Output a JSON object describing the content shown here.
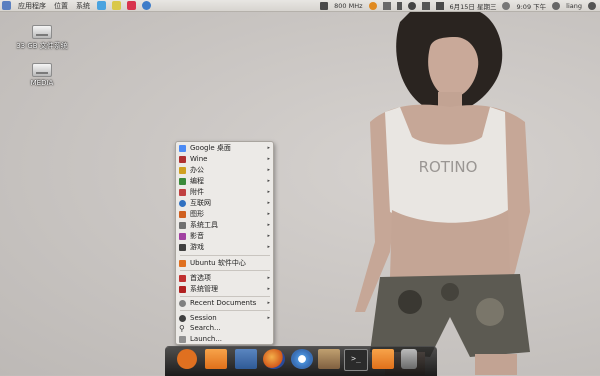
{
  "panel": {
    "menus": [
      "应用程序",
      "位置",
      "系统"
    ],
    "cpu": "800 MHz",
    "datetime": "6月15日 星期三",
    "time": "9:09 下午",
    "user": "liang"
  },
  "desktop": {
    "icons": [
      {
        "label": "33 GB 文件系统"
      },
      {
        "label": "MEDIA"
      }
    ]
  },
  "menu": {
    "items": [
      {
        "label": "Google 桌面",
        "icon": "google-icon",
        "color": "#4c8bf5",
        "submenu": true
      },
      {
        "label": "Wine",
        "icon": "wine-icon",
        "color": "#b03030",
        "submenu": true
      },
      {
        "label": "办公",
        "icon": "office-icon",
        "color": "#d0a020",
        "submenu": true
      },
      {
        "label": "编程",
        "icon": "programming-icon",
        "color": "#3a8a3a",
        "submenu": true
      },
      {
        "label": "附件",
        "icon": "accessories-icon",
        "color": "#c04040",
        "submenu": true
      },
      {
        "label": "互联网",
        "icon": "internet-icon",
        "color": "#3070c0",
        "submenu": true
      },
      {
        "label": "图形",
        "icon": "graphics-icon",
        "color": "#d06020",
        "submenu": true
      },
      {
        "label": "系统工具",
        "icon": "system-tools-icon",
        "color": "#707070",
        "submenu": true
      },
      {
        "label": "影音",
        "icon": "multimedia-icon",
        "color": "#a040a0",
        "submenu": true
      },
      {
        "label": "游戏",
        "icon": "games-icon",
        "color": "#404040",
        "submenu": true
      },
      {
        "label": "Ubuntu 软件中心",
        "icon": "software-center-icon",
        "color": "#e07020",
        "submenu": false
      },
      {
        "label": "首选项",
        "icon": "preferences-icon",
        "color": "#c03030",
        "submenu": true
      },
      {
        "label": "系统管理",
        "icon": "administration-icon",
        "color": "#b02020",
        "submenu": true
      },
      {
        "label": "Recent Documents",
        "icon": "recent-documents-icon",
        "color": "#808080",
        "submenu": true
      },
      {
        "label": "Session",
        "icon": "session-icon",
        "color": "#404040",
        "submenu": true
      },
      {
        "label": "Search...",
        "icon": "search-icon",
        "color": "#333333",
        "submenu": false
      },
      {
        "label": "Launch...",
        "icon": "launch-icon",
        "color": "#909090",
        "submenu": false
      }
    ]
  },
  "dock": {
    "items": [
      {
        "name": "ubuntu-menu-icon",
        "color": "#e07020"
      },
      {
        "name": "home-folder-icon",
        "color": "#f08a30"
      },
      {
        "name": "save-disk-icon",
        "color": "#3060a0"
      },
      {
        "name": "firefox-icon",
        "color": "#e06a10"
      },
      {
        "name": "chromium-icon",
        "color": "#4a90d9"
      },
      {
        "name": "archive-manager-icon",
        "color": "#a07040"
      },
      {
        "name": "terminal-icon",
        "color": "#2b2b2b"
      },
      {
        "name": "folder-icon",
        "color": "#f08a30"
      },
      {
        "name": "media-player-icon",
        "color": "#909090"
      }
    ]
  }
}
